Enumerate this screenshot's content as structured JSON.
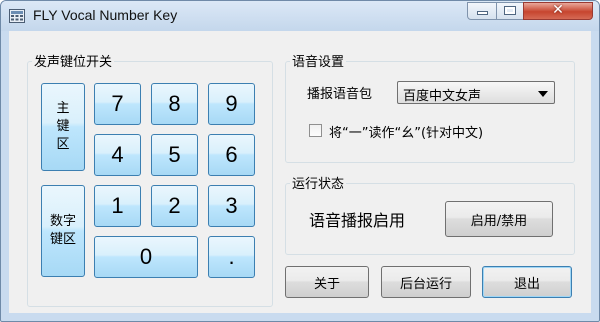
{
  "window": {
    "title": "FLY Vocal Number Key",
    "close_glyph": "✕"
  },
  "left_group": {
    "label": "发声键位开关",
    "main_key": "主\n键\n区",
    "numpad_key": "数字\n键区",
    "digits": [
      "7",
      "8",
      "9",
      "4",
      "5",
      "6",
      "1",
      "2",
      "3",
      "0",
      "."
    ]
  },
  "voice_settings": {
    "label": "语音设置",
    "pack_label": "播报语音包",
    "pack_value": "百度中文女声",
    "checkbox_label": "将“一”读作“幺”(针对中文)",
    "checkbox_checked": false
  },
  "run_status": {
    "label": "运行状态",
    "status_text": "语音播报启用",
    "toggle_label": "启用/禁用"
  },
  "buttons": {
    "about": "关于",
    "background": "后台运行",
    "exit": "退出"
  }
}
